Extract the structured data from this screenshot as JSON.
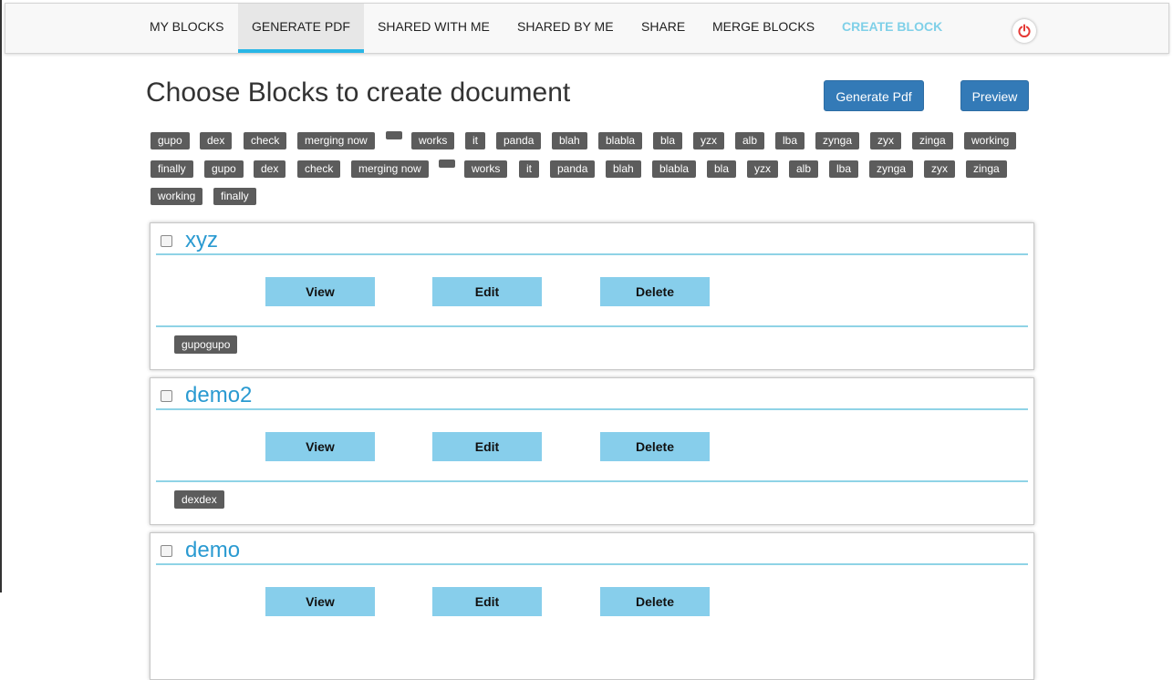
{
  "nav": {
    "items": [
      "MY BLOCKS",
      "GENERATE PDF",
      "SHARED WITH ME",
      "SHARED BY ME",
      "SHARE",
      "MERGE BLOCKS",
      "CREATE BLOCK"
    ],
    "active": "GENERATE PDF",
    "highlight": "CREATE BLOCK",
    "power_icon": "power-icon",
    "power_color": "#e53935"
  },
  "page": {
    "title": "Choose Blocks to create document",
    "generate_pdf_label": "Generate Pdf",
    "preview_label": "Preview"
  },
  "tags": [
    "gupo",
    "dex",
    "check",
    "merging now",
    "",
    "works",
    "it",
    "panda",
    "blah",
    "blabla",
    "bla",
    "yzx",
    "alb",
    "lba",
    "zynga",
    "zyx",
    "zinga",
    "working",
    "finally",
    "gupo",
    "dex",
    "check",
    "merging now",
    "",
    "works",
    "it",
    "panda",
    "blah",
    "blabla",
    "bla",
    "yzx",
    "alb",
    "lba",
    "zynga",
    "zyx",
    "zinga",
    "working",
    "finally"
  ],
  "blocks": [
    {
      "title": "xyz",
      "view": "View",
      "edit": "Edit",
      "delete": "Delete",
      "tag": "gupogupo"
    },
    {
      "title": "demo2",
      "view": "View",
      "edit": "Edit",
      "delete": "Delete",
      "tag": "dexdex"
    },
    {
      "title": "demo",
      "view": "View",
      "edit": "Edit",
      "delete": "Delete",
      "tag": ""
    }
  ],
  "colors": {
    "accent": "#29b6e6",
    "title": "#2a9ad1",
    "action": "#87ceeb",
    "primary": "#337ab7",
    "tag": "#5c5c5c"
  }
}
